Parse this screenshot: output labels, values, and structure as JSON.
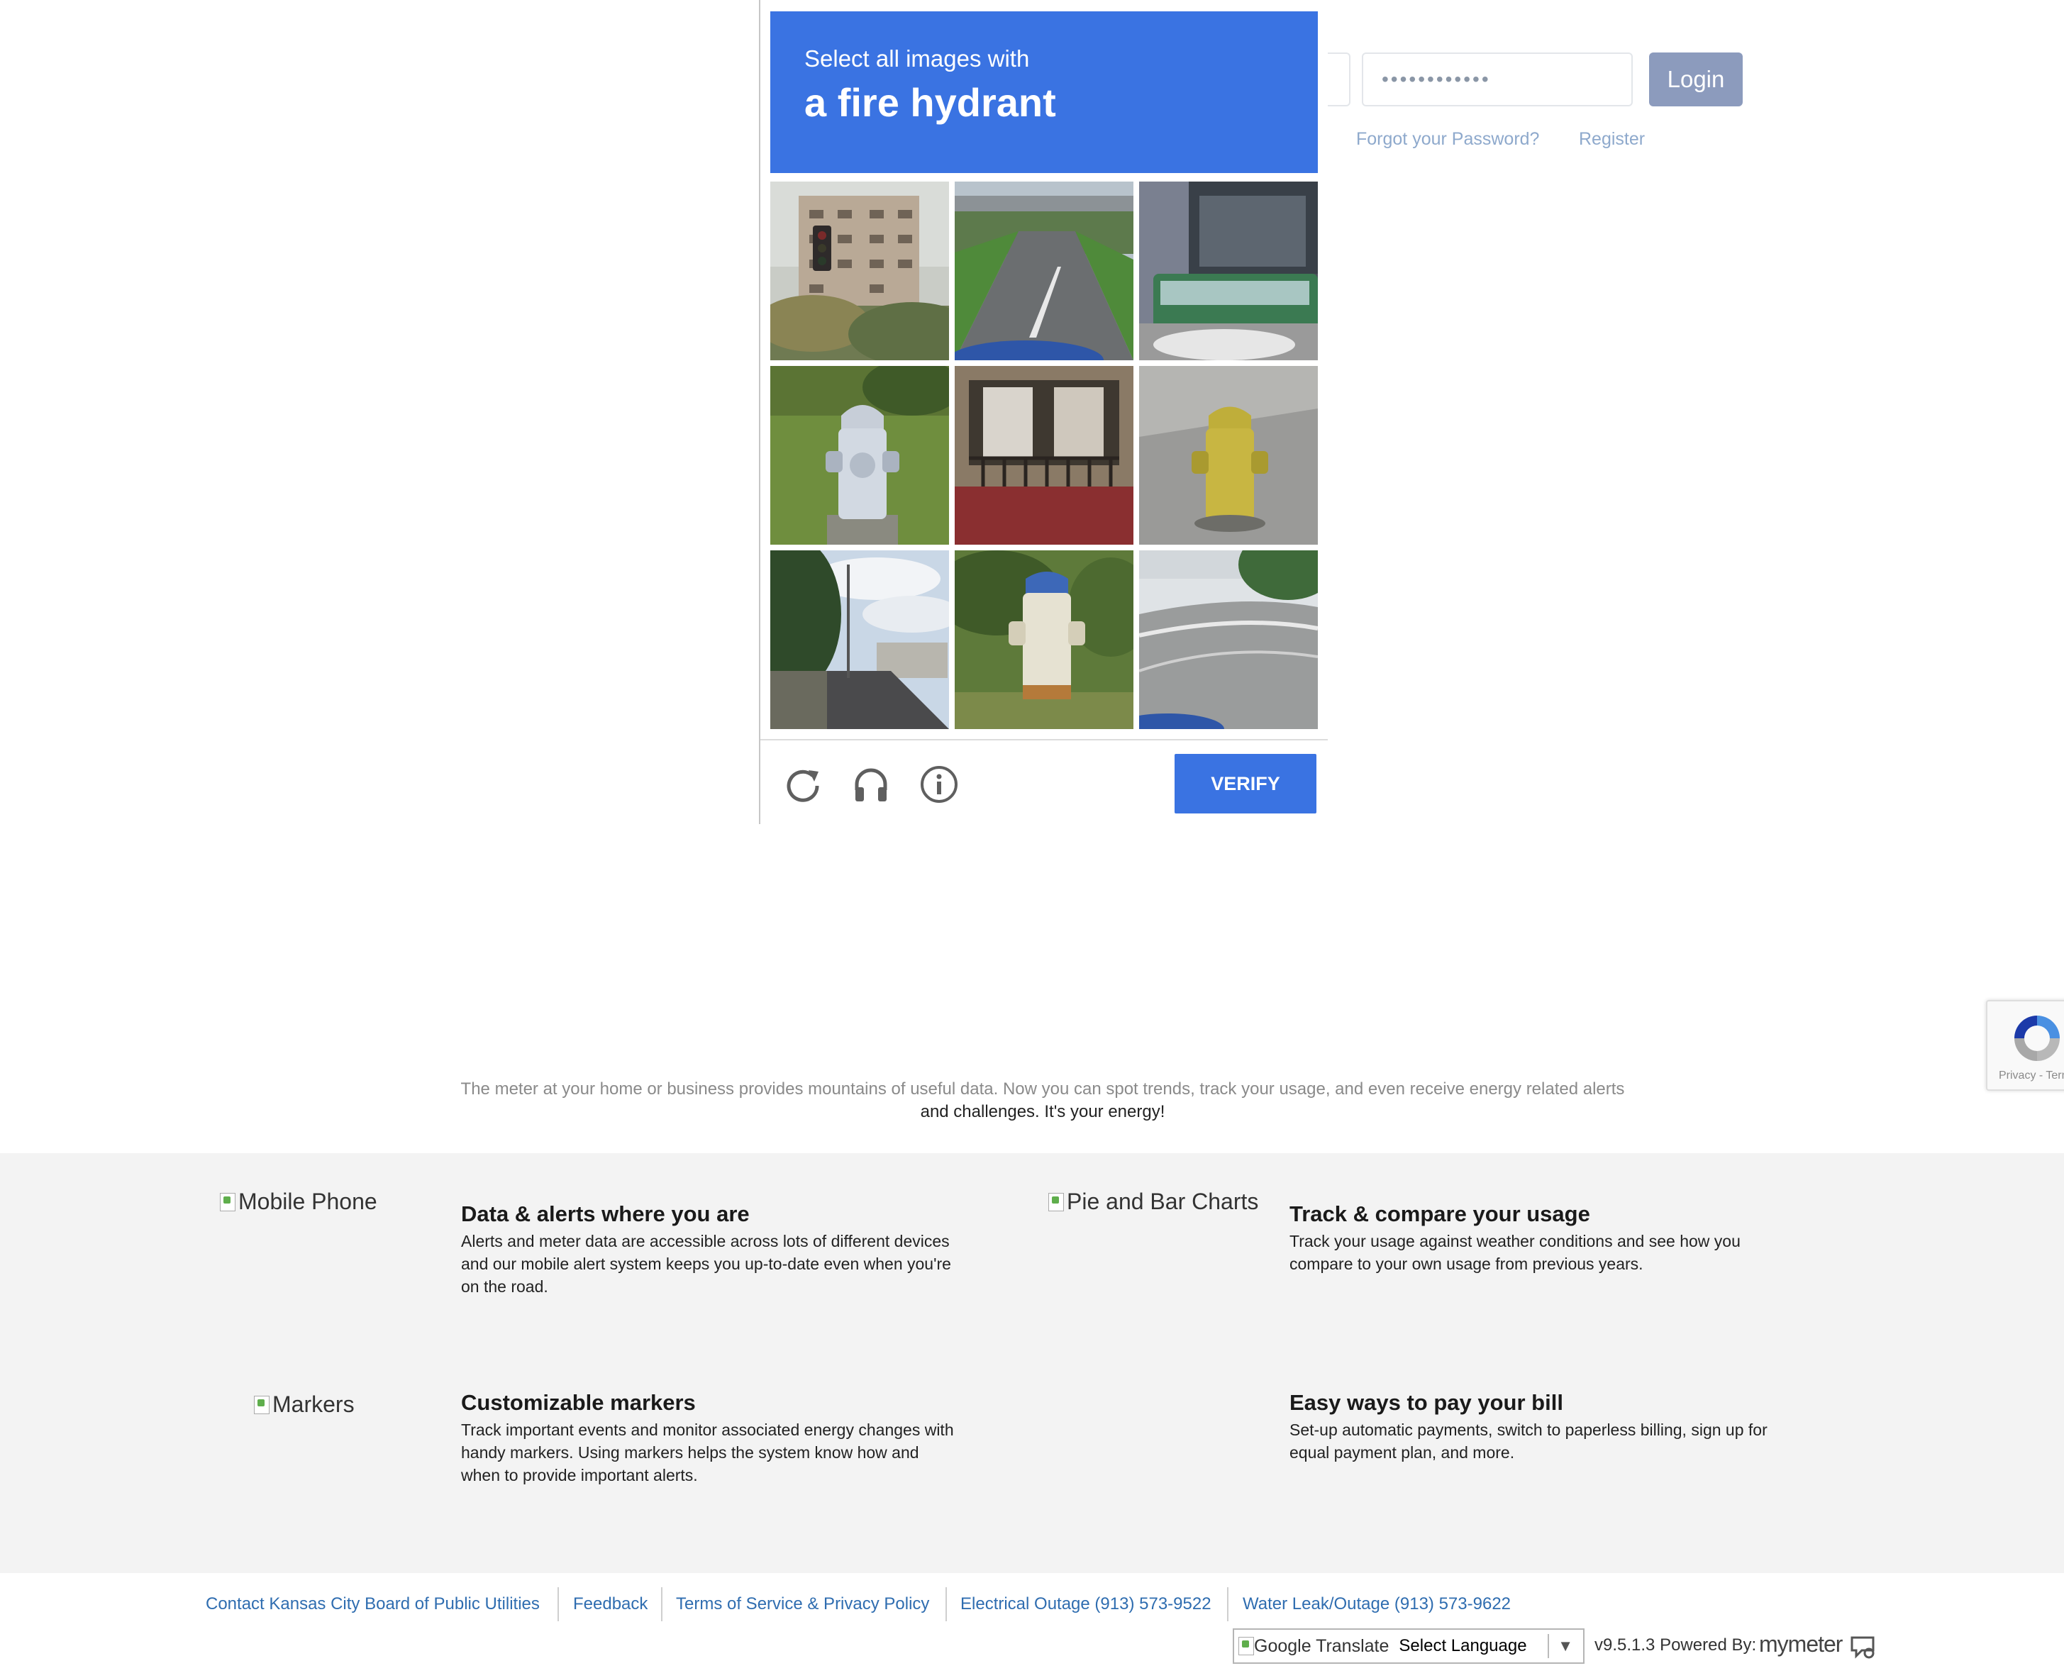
{
  "login": {
    "password_value": "••••••••••••",
    "login_label": "Login",
    "forgot_label": "Forgot your Password?",
    "register_label": "Register"
  },
  "captcha": {
    "instruction_line1": "Select all images with",
    "instruction_line2": "a fire hydrant",
    "tiles": [
      "tall building with traffic light",
      "road under overpass",
      "bus at station",
      "silver fire hydrant on grass",
      "building balcony",
      "yellow fire hydrant on sidewalk",
      "street with palm trees",
      "white fire hydrant with blue cap",
      "curving highway"
    ],
    "icons": [
      "reload-icon",
      "audio-headphones-icon",
      "info-icon"
    ],
    "verify_label": "VERIFY",
    "accent_color": "#3a73e2"
  },
  "recaptcha_badge": {
    "text": "Privacy - Terms"
  },
  "tagline": {
    "line1": "The meter at your home or business provides mountains of useful data. Now you can spot trends, track your usage, and even receive energy related alerts",
    "line2": "and challenges. It's your energy!"
  },
  "features": [
    {
      "image_alt": "Mobile Phone",
      "title": "Data & alerts where you are",
      "desc": "Alerts and meter data are accessible across lots of different devices and our mobile alert system keeps you up-to-date even when you're on the road."
    },
    {
      "image_alt": "Pie and Bar Charts",
      "title": "Track & compare your usage",
      "desc": "Track your usage against weather conditions and see how you compare to your own usage from previous years."
    },
    {
      "image_alt": "Markers",
      "title": "Customizable markers",
      "desc": "Track important events and monitor associated energy changes with handy markers. Using markers helps the system know how and when to provide important alerts."
    },
    {
      "image_alt": "",
      "title": "Easy ways to pay your bill",
      "desc": "Set-up automatic payments, switch to paperless billing, sign up for equal payment plan, and more."
    }
  ],
  "footer": {
    "links": [
      "Contact Kansas City Board of Public Utilities",
      "Feedback",
      "Terms of Service & Privacy Policy",
      "Electrical Outage (913) 573-9522",
      "Water Leak/Outage (913) 573-9622"
    ],
    "translate_alt": "Google Translate",
    "language_select": "Select Language",
    "version": "v9.5.1.3 Powered By:",
    "brand": "mymeter"
  }
}
